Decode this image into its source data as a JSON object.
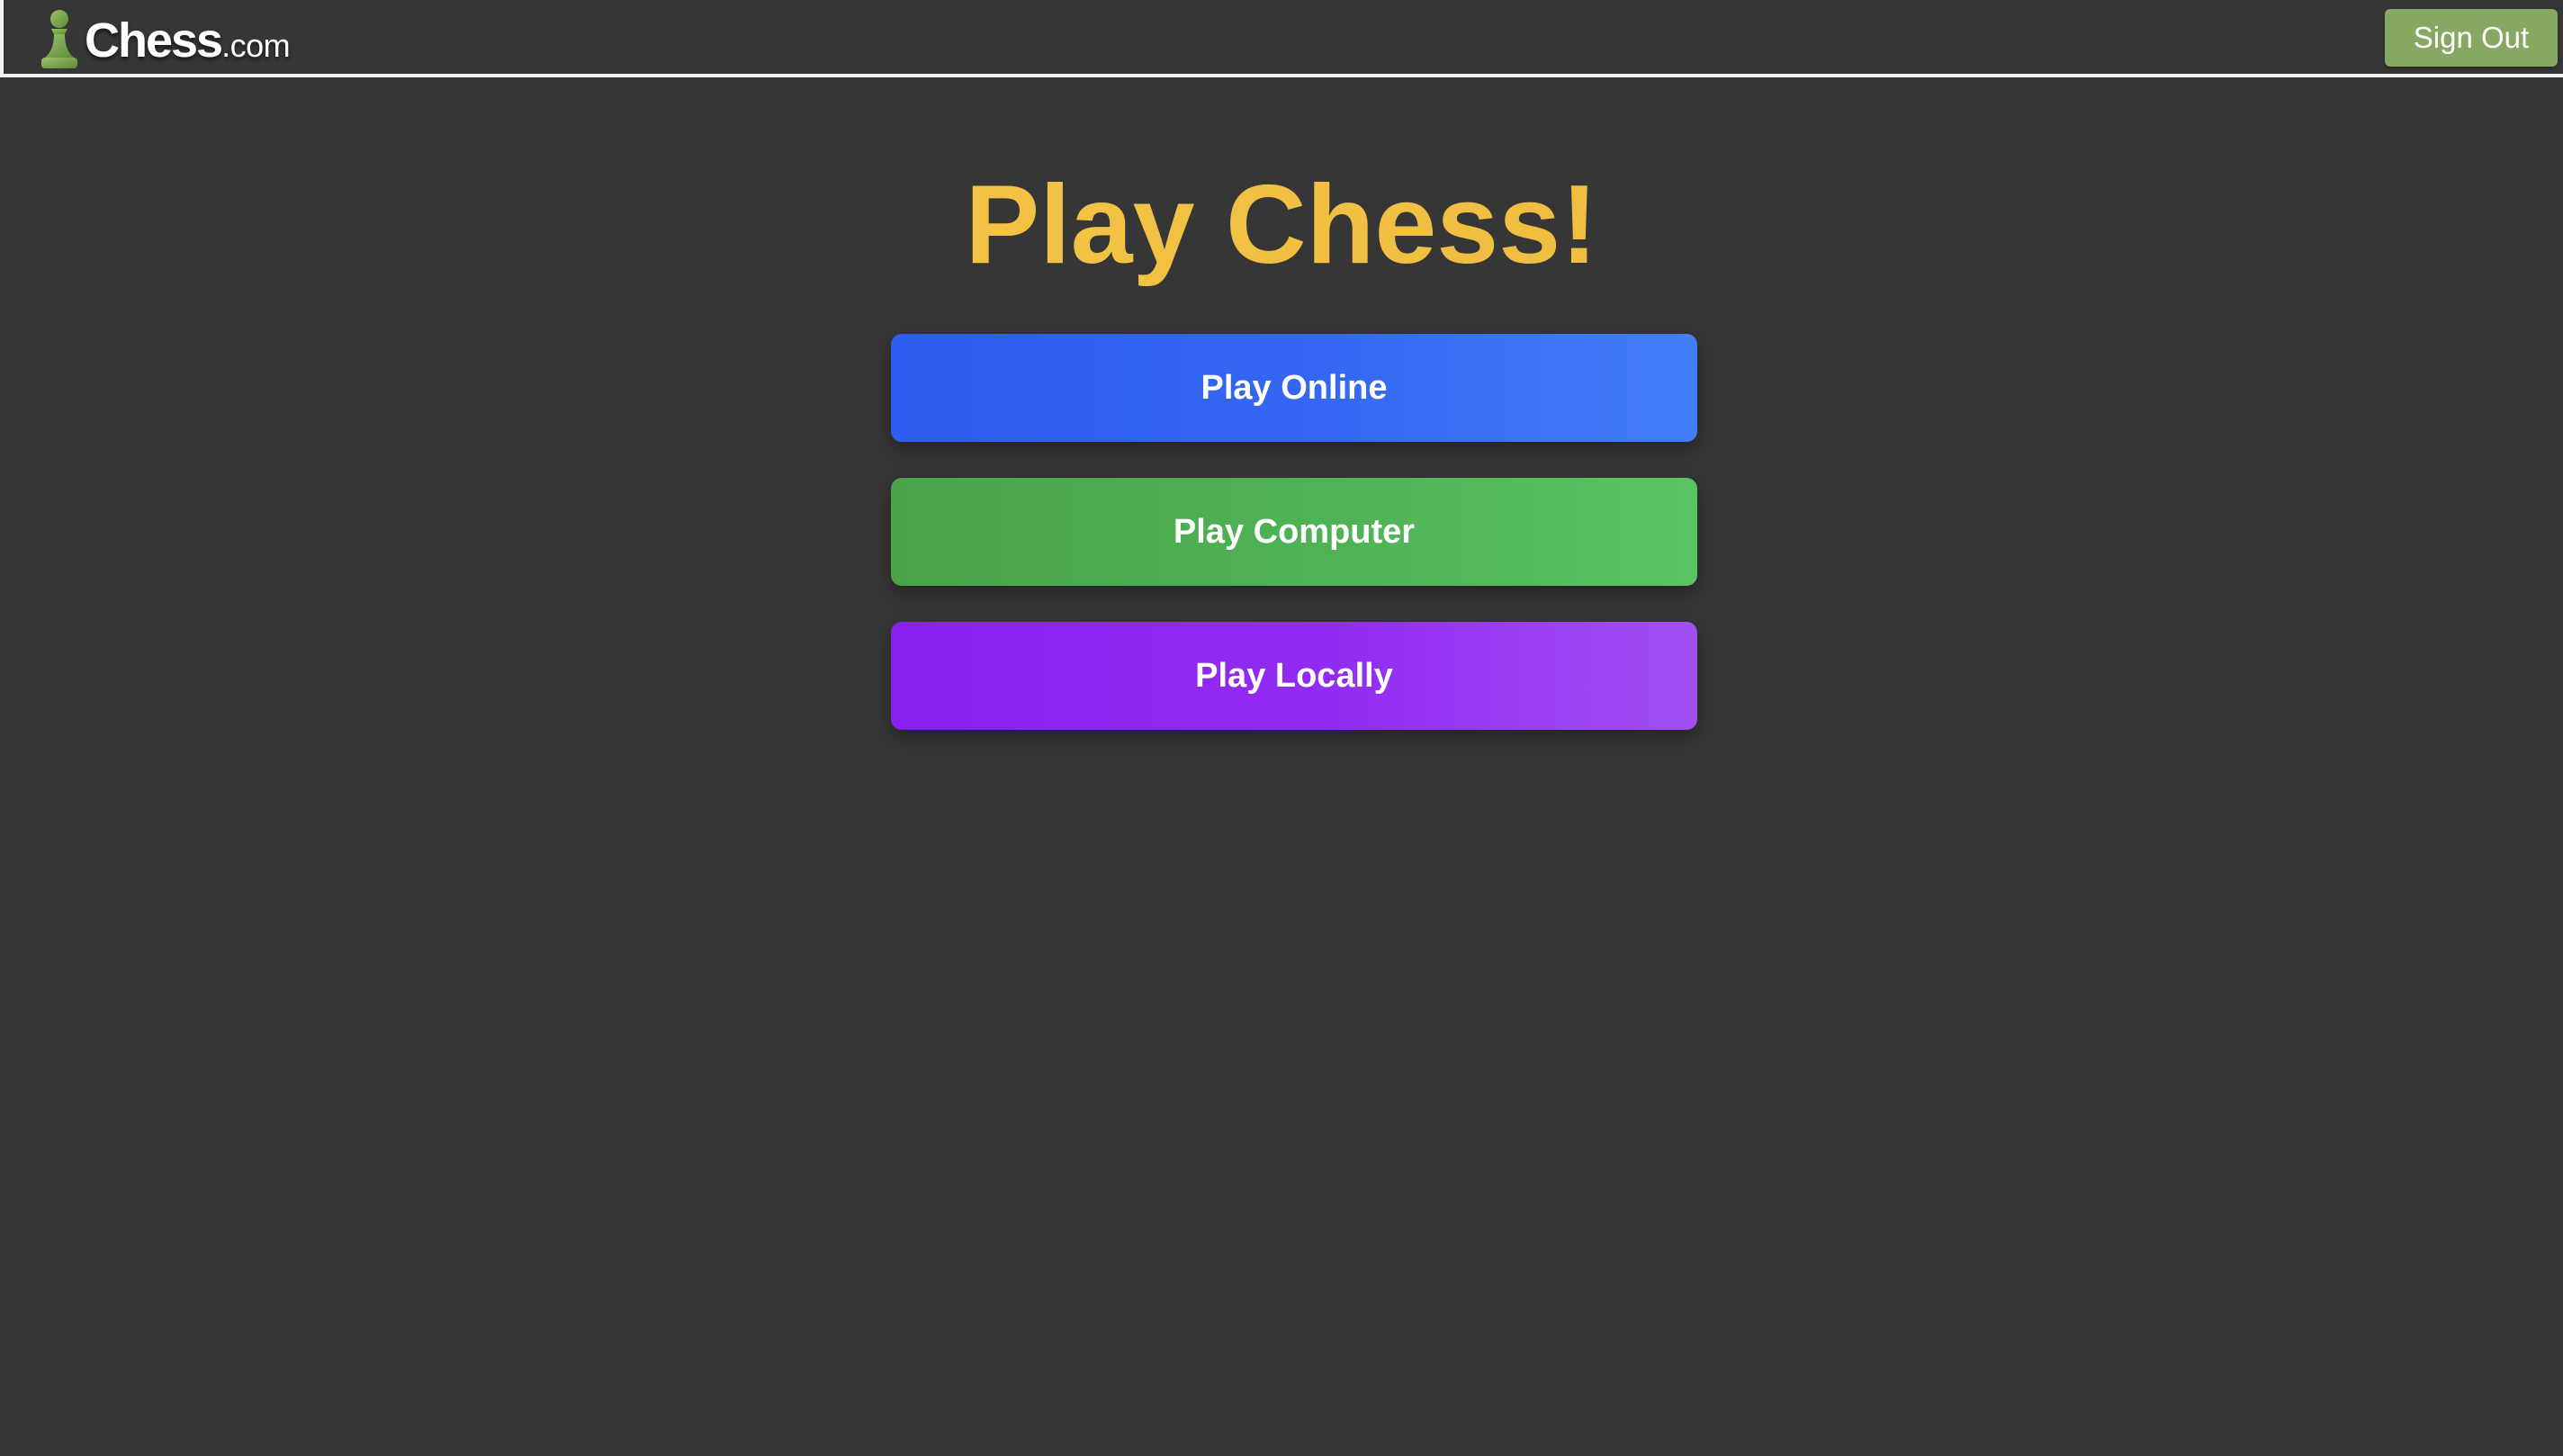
{
  "header": {
    "logo": {
      "name": "Chess",
      "domain": ".com",
      "icon": "pawn-icon",
      "icon_color": "#7fa650"
    },
    "sign_out_label": "Sign Out",
    "sign_out_color": "#87a862"
  },
  "main": {
    "title": "Play Chess!",
    "title_color": "#f3c23f",
    "buttons": [
      {
        "label": "Play Online",
        "color": "#3468f3"
      },
      {
        "label": "Play Computer",
        "color": "#4fb355"
      },
      {
        "label": "Play Locally",
        "color": "#922cf3"
      }
    ]
  },
  "theme": {
    "background": "#363636"
  }
}
